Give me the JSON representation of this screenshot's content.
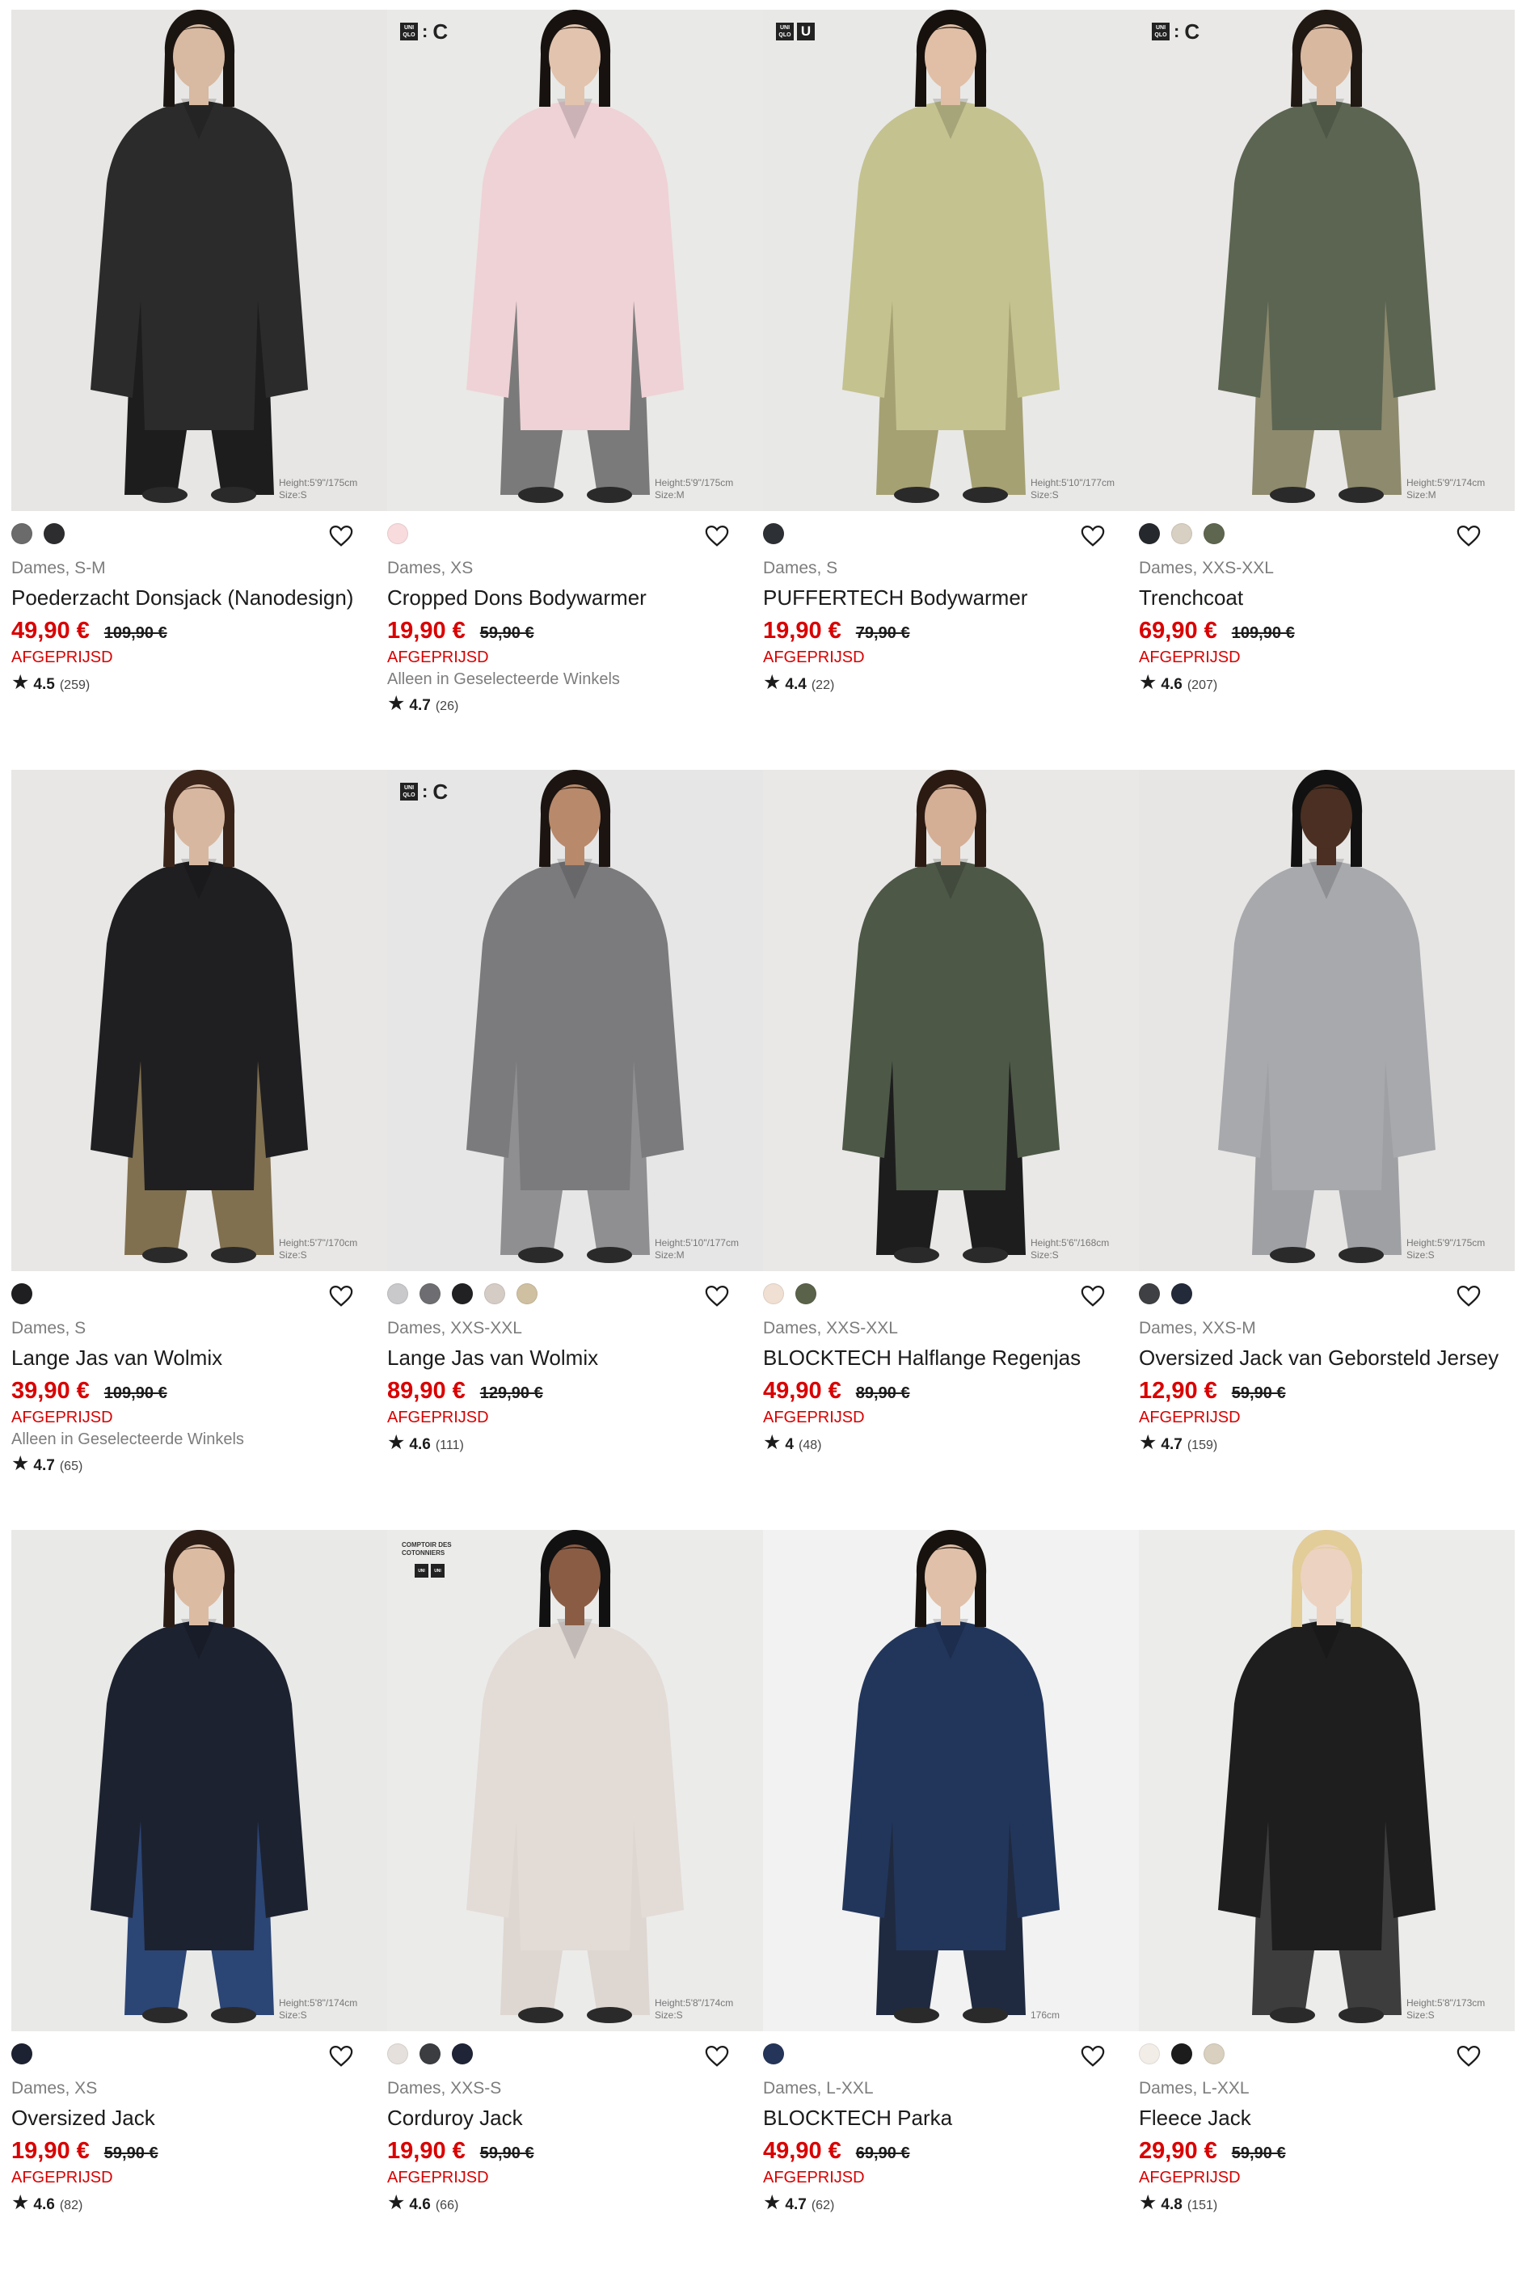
{
  "products": [
    {
      "brand": "",
      "model_height": "Height:5'9\"/175cm",
      "model_size": "Size:S",
      "bg": "#e7e6e4",
      "garment": "#2b2b2b",
      "trouser": "#1d1d1d",
      "skin": "#d8b9a1",
      "hair": "#1b1511",
      "colors": [
        "#6b6b6b",
        "#2d2d2f"
      ],
      "sizes": "Dames, S-M",
      "name": "Poederzacht Donsjack (Nanodesign)",
      "price": "49,90 €",
      "old_price": "109,90 €",
      "discount": "AFGEPRIJSD",
      "store_note": "",
      "rating": "4.5",
      "reviews": "(259)"
    },
    {
      "brand": "uniqlo-c",
      "model_height": "Height:5'9\"/175cm",
      "model_size": "Size:M",
      "bg": "#e9e9e7",
      "garment": "#efd2d6",
      "trouser": "#7a7a7a",
      "skin": "#e2c3ad",
      "hair": "#17120f",
      "colors": [
        "#f8dbdd"
      ],
      "sizes": "Dames, XS",
      "name": "Cropped Dons Bodywarmer",
      "price": "19,90 €",
      "old_price": "59,90 €",
      "discount": "AFGEPRIJSD",
      "store_note": "Alleen in Geselecteerde Winkels",
      "rating": "4.7",
      "reviews": "(26)"
    },
    {
      "brand": "uniqlo-u",
      "model_height": "Height:5'10\"/177cm",
      "model_size": "Size:S",
      "bg": "#e8e8e7",
      "garment": "#c4c28f",
      "trouser": "#a6a173",
      "skin": "#e0bfa6",
      "hair": "#16110d",
      "colors": [
        "#2d3034"
      ],
      "sizes": "Dames, S",
      "name": "PUFFERTECH Bodywarmer",
      "price": "19,90 €",
      "old_price": "79,90 €",
      "discount": "AFGEPRIJSD",
      "store_note": "",
      "rating": "4.4",
      "reviews": "(22)"
    },
    {
      "brand": "uniqlo-c",
      "model_height": "Height:5'9\"/174cm",
      "model_size": "Size:M",
      "bg": "#e9e8e6",
      "garment": "#5c6552",
      "trouser": "#8d8a6d",
      "skin": "#d9b8a0",
      "hair": "#201812",
      "colors": [
        "#25282c",
        "#d8d0c2",
        "#5e664f"
      ],
      "sizes": "Dames, XXS-XXL",
      "name": "Trenchcoat",
      "price": "69,90 €",
      "old_price": "109,90 €",
      "discount": "AFGEPRIJSD",
      "store_note": "",
      "rating": "4.6",
      "reviews": "(207)"
    },
    {
      "brand": "",
      "model_height": "Height:5'7\"/170cm",
      "model_size": "Size:S",
      "bg": "#e8e7e5",
      "garment": "#1f1f22",
      "trouser": "#80704f",
      "skin": "#d8b7a0",
      "hair": "#3a2419",
      "colors": [
        "#1f1f21"
      ],
      "sizes": "Dames, S",
      "name": "Lange Jas van Wolmix",
      "price": "39,90 €",
      "old_price": "109,90 €",
      "discount": "AFGEPRIJSD",
      "store_note": "Alleen in Geselecteerde Winkels",
      "rating": "4.7",
      "reviews": "(65)"
    },
    {
      "brand": "uniqlo-c",
      "model_height": "Height:5'10\"/177cm",
      "model_size": "Size:M",
      "bg": "#e6e6e6",
      "garment": "#7b7b7d",
      "trouser": "#8f8f91",
      "skin": "#b8896b",
      "hair": "#1b1410",
      "colors": [
        "#c9c9cc",
        "#6e6e72",
        "#212123",
        "#d5ccc5",
        "#cfc0a1"
      ],
      "sizes": "Dames, XXS-XXL",
      "name": "Lange Jas van Wolmix",
      "price": "89,90 €",
      "old_price": "129,90 €",
      "discount": "AFGEPRIJSD",
      "store_note": "",
      "rating": "4.6",
      "reviews": "(111)"
    },
    {
      "brand": "",
      "model_height": "Height:5'6\"/168cm",
      "model_size": "Size:S",
      "bg": "#e9e8e6",
      "garment": "#4d5847",
      "trouser": "#1d1d1e",
      "skin": "#d4ae95",
      "hair": "#2a1a12",
      "colors": [
        "#f0dfd3",
        "#5a6349"
      ],
      "sizes": "Dames, XXS-XXL",
      "name": "BLOCKTECH Halflange Regenjas",
      "price": "49,90 €",
      "old_price": "89,90 €",
      "discount": "AFGEPRIJSD",
      "store_note": "",
      "rating": "4",
      "reviews": "(48)"
    },
    {
      "brand": "",
      "model_height": "Height:5'9\"/175cm",
      "model_size": "Size:S",
      "bg": "#e7e6e4",
      "garment": "#a7a9ad",
      "trouser": "#9ea0a4",
      "skin": "#4a2f22",
      "hair": "#111111",
      "colors": [
        "#3f4043",
        "#232a3a"
      ],
      "sizes": "Dames, XXS-M",
      "name": "Oversized Jack van Geborsteld Jersey",
      "price": "12,90 €",
      "old_price": "59,90 €",
      "discount": "AFGEPRIJSD",
      "store_note": "",
      "rating": "4.7",
      "reviews": "(159)"
    },
    {
      "brand": "",
      "model_height": "Height:5'8\"/174cm",
      "model_size": "Size:S",
      "bg": "#e9e9e8",
      "garment": "#1d2230",
      "trouser": "#2b4575",
      "skin": "#dcbba3",
      "hair": "#2a1c15",
      "colors": [
        "#1d2232"
      ],
      "sizes": "Dames, XS",
      "name": "Oversized Jack",
      "price": "19,90 €",
      "old_price": "59,90 €",
      "discount": "AFGEPRIJSD",
      "store_note": "",
      "rating": "4.6",
      "reviews": "(82)"
    },
    {
      "brand": "comptoir",
      "brand_text": "COMPTOIR DES COTONNIERS",
      "model_height": "Height:5'8\"/174cm",
      "model_size": "Size:S",
      "bg": "#ebebea",
      "garment": "#e3dbd6",
      "trouser": "#ded6d1",
      "skin": "#8a5c44",
      "hair": "#111111",
      "colors": [
        "#e5e0dc",
        "#3b3d40",
        "#1f2436"
      ],
      "sizes": "Dames, XXS-S",
      "name": "Corduroy Jack",
      "price": "19,90 €",
      "old_price": "59,90 €",
      "discount": "AFGEPRIJSD",
      "store_note": "",
      "rating": "4.6",
      "reviews": "(66)"
    },
    {
      "brand": "",
      "model_height": "176cm",
      "model_size": "",
      "bg": "#f2f2f2",
      "garment": "#22365c",
      "trouser": "#1f2a40",
      "skin": "#e0c0a8",
      "hair": "#17120e",
      "colors": [
        "#253559"
      ],
      "sizes": "Dames, L-XXL",
      "name": "BLOCKTECH Parka",
      "price": "49,90 €",
      "old_price": "69,90 €",
      "discount": "AFGEPRIJSD",
      "store_note": "",
      "rating": "4.7",
      "reviews": "(62)"
    },
    {
      "brand": "",
      "model_height": "Height:5'8\"/173cm",
      "model_size": "Size:S",
      "bg": "#ececeb",
      "garment": "#1e1e1e",
      "trouser": "#3d3d3d",
      "skin": "#ecd2c0",
      "hair": "#e2cc98",
      "colors": [
        "#f3ede8",
        "#1c1c1d",
        "#d9d0bf"
      ],
      "sizes": "Dames, L-XXL",
      "name": "Fleece Jack",
      "price": "29,90 €",
      "old_price": "59,90 €",
      "discount": "AFGEPRIJSD",
      "store_note": "",
      "rating": "4.8",
      "reviews": "(151)"
    }
  ],
  "icons": {
    "wishlist": "heart-outline-icon",
    "rating": "star-icon"
  }
}
